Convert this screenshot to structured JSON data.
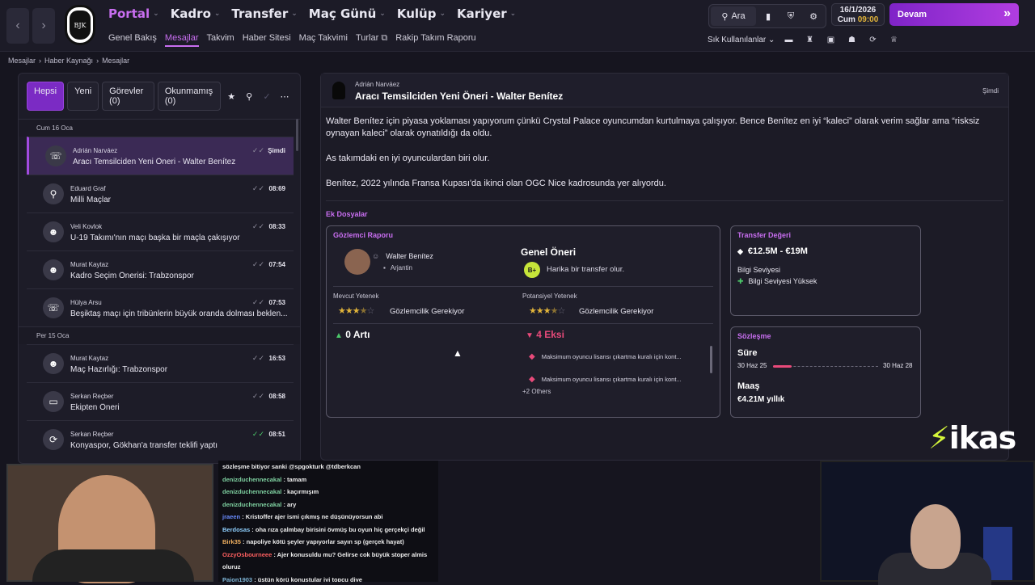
{
  "nav": {
    "back": "‹",
    "forward": "›",
    "crest_text": "BJK",
    "main": [
      {
        "label": "Portal",
        "active": true
      },
      {
        "label": "Kadro",
        "active": false
      },
      {
        "label": "Transfer",
        "active": false
      },
      {
        "label": "Maç Günü",
        "active": false
      },
      {
        "label": "Kulüp",
        "active": false
      },
      {
        "label": "Kariyer",
        "active": false
      }
    ],
    "sub": [
      {
        "label": "Genel Bakış",
        "active": false
      },
      {
        "label": "Mesajlar",
        "active": true
      },
      {
        "label": "Takvim",
        "active": false
      },
      {
        "label": "Haber Sitesi",
        "active": false
      },
      {
        "label": "Maç Takvimi",
        "active": false
      },
      {
        "label": "Turlar",
        "active": false
      },
      {
        "label": "Rakip Takım Raporu",
        "active": false
      }
    ],
    "search_label": "Ara",
    "date": "16/1/2026",
    "day": "Cum",
    "time": "09:00",
    "continue_label": "Devam",
    "frequent_label": "Sık Kullanılanlar"
  },
  "breadcrumb": [
    "Mesajlar",
    "Haber Kaynağı",
    "Mesajlar"
  ],
  "inbox": {
    "tabs": [
      {
        "label": "Hepsi",
        "active": true
      },
      {
        "label": "Yeni",
        "active": false
      },
      {
        "label": "Görevler (0)",
        "active": false
      },
      {
        "label": "Okunmamış (0)",
        "active": false
      }
    ],
    "day1": "Cum 16 Oca",
    "day2": "Per 15 Oca",
    "messages_day1": [
      {
        "from": "Adrián Narváez",
        "subject": "Aracı Temsilciden Yeni Öneri - Walter Benítez",
        "time": "Şimdi",
        "icon": "agent-icon",
        "glyph": "☏",
        "active": true,
        "read_green": false
      },
      {
        "from": "Eduard Graf",
        "subject": "Milli Maçlar",
        "time": "08:69",
        "icon": "search-icon",
        "glyph": "⚲",
        "active": false,
        "read_green": false
      },
      {
        "from": "Veli Kovlok",
        "subject": "U-19 Takımı'nın maçı başka bir maçla çakışıyor",
        "time": "08:33",
        "icon": "group-icon",
        "glyph": "☻",
        "active": false,
        "read_green": false
      },
      {
        "from": "Murat Kaytaz",
        "subject": "Kadro Seçim Önerisi: Trabzonspor",
        "time": "07:54",
        "icon": "group-icon",
        "glyph": "☻",
        "active": false,
        "read_green": false
      },
      {
        "from": "Hülya Arsu",
        "subject": "Beşiktaş maçı için tribünlerin büyük oranda dolması beklen...",
        "time": "07:53",
        "icon": "agent-icon",
        "glyph": "☏",
        "active": false,
        "read_green": false
      }
    ],
    "messages_day2": [
      {
        "from": "Murat Kaytaz",
        "subject": "Maç Hazırlığı: Trabzonspor",
        "time": "16:53",
        "icon": "group-icon",
        "glyph": "☻",
        "active": false,
        "read_green": false
      },
      {
        "from": "Serkan Reçber",
        "subject": "Ekipten Öneri",
        "time": "08:58",
        "icon": "briefcase-icon",
        "glyph": "▭",
        "active": false,
        "read_green": false
      },
      {
        "from": "Serkan Reçber",
        "subject": "Konyaspor, Gökhan'a transfer teklifi yaptı",
        "time": "08:51",
        "icon": "refresh-icon",
        "glyph": "⟳",
        "active": false,
        "read_green": true
      }
    ]
  },
  "message": {
    "from": "Adrián Narváez",
    "title": "Aracı Temsilciden Yeni Öneri - Walter Benítez",
    "time": "Şimdi",
    "p1": "Walter Benítez için piyasa yoklaması yapıyorum çünkü Crystal Palace oyuncumdan kurtulmaya çalışıyor. Bence Benítez en iyi “kaleci” olarak verim sağlar ama “risksiz oynayan kaleci” olarak oynatıldığı da oldu.",
    "p2": "As takımdaki en iyi oyunculardan biri olur.",
    "p3": "Benítez, 2022 yılında Fransa Kupası'da ikinci olan OGC Nice kadrosunda yer alıyordu.",
    "attachments_label": "Ek Dosyalar"
  },
  "scout": {
    "heading": "Gözlemci Raporu",
    "player_name": "Walter Benítez",
    "nationality": "Arjantin",
    "overall_heading": "Genel Öneri",
    "grade": "B+",
    "grade_text": "Harika bir transfer olur.",
    "current_label": "Mevcut Yetenek",
    "potential_label": "Potansiyel Yetenek",
    "current_stars": 3.5,
    "potential_stars": 3.5,
    "needs_scouting": "Gözlemcilik Gerekiyor",
    "pros_label": "0 Artı",
    "cons_label": "4 Eksi",
    "cons": [
      "Maksimum oyuncu lisansı çıkartma kuralı için kont...",
      "Maksimum oyuncu lisansı çıkartma kuralı için kont..."
    ],
    "others": "+2 Others"
  },
  "transfer": {
    "heading": "Transfer Değeri",
    "range": "€12.5M - €19M",
    "info_label": "Bilgi Seviyesi",
    "info_value": "Bilgi Seviyesi Yüksek"
  },
  "contract": {
    "heading": "Sözleşme",
    "duration_label": "Süre",
    "start": "30 Haz 25",
    "end": "30 Haz 28",
    "elapsed_fraction": 0.18,
    "salary_label": "Maaş",
    "salary": "€4.21M yıllık"
  },
  "chat": [
    {
      "user": "",
      "text": "sözleşme bitiyor sanki @spgokturk @tdberkcan",
      "color": "#7fb6d8"
    },
    {
      "user": "denizduchennecakal",
      "text": "tamam",
      "color": "#7ed0a0"
    },
    {
      "user": "denizduchennecakal",
      "text": "kaçırmışım",
      "color": "#7ed0a0"
    },
    {
      "user": "denizduchennecakal",
      "text": "ary",
      "color": "#7ed0a0"
    },
    {
      "user": "jraeen",
      "text": "Kristoffer ajer ismi çıkmış ne düşünüyorsun abi",
      "color": "#6a8cff"
    },
    {
      "user": "Berdosas",
      "text": "oha rıza çalmbay birisini övmüş bu oyun hiç gerçekçi değil",
      "color": "#8fd0ff"
    },
    {
      "user": "Birk35",
      "text": "napoliye kötü şeyler yapıyorlar sayın sp (gerçek hayat)",
      "color": "#f0b060"
    },
    {
      "user": "OzzyOsbourneee",
      "text": "Ajer konusuldu mu? Gelirse cok büyük stoper almis oluruz",
      "color": "#ff6060"
    },
    {
      "user": "Paion1903",
      "text": "üstün körü konuştular iyi topçu diye",
      "color": "#7fb6d8"
    }
  ],
  "brand": "ikas"
}
